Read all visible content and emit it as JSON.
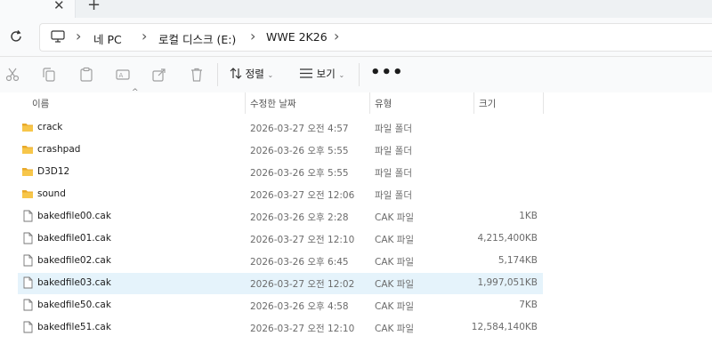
{
  "tab": {
    "close_glyph": "✕",
    "new_glyph": "+"
  },
  "breadcrumb": [
    "네 PC",
    "로컬 디스크 (E:)",
    "WWE 2K26"
  ],
  "toolbar": {
    "sort_label": "정렬",
    "view_label": "보기",
    "more_label": "•••"
  },
  "columns": {
    "name": "이름",
    "date": "수정한 날짜",
    "type": "유형",
    "size": "크기"
  },
  "files": [
    {
      "name": "crack",
      "date": "2026-03-27 오전 4:57",
      "type": "파일 폴더",
      "size": "",
      "kind": "folder"
    },
    {
      "name": "crashpad",
      "date": "2026-03-26 오후 5:55",
      "type": "파일 폴더",
      "size": "",
      "kind": "folder"
    },
    {
      "name": "D3D12",
      "date": "2026-03-26 오후 5:55",
      "type": "파일 폴더",
      "size": "",
      "kind": "folder"
    },
    {
      "name": "sound",
      "date": "2026-03-27 오전 12:06",
      "type": "파일 폴더",
      "size": "",
      "kind": "folder"
    },
    {
      "name": "bakedfile00.cak",
      "date": "2026-03-26 오후 2:28",
      "type": "CAK 파일",
      "size": "1KB",
      "kind": "file"
    },
    {
      "name": "bakedfile01.cak",
      "date": "2026-03-27 오전 12:10",
      "type": "CAK 파일",
      "size": "4,215,400KB",
      "kind": "file"
    },
    {
      "name": "bakedfile02.cak",
      "date": "2026-03-26 오후 6:45",
      "type": "CAK 파일",
      "size": "5,174KB",
      "kind": "file"
    },
    {
      "name": "bakedfile03.cak",
      "date": "2026-03-27 오전 12:02",
      "type": "CAK 파일",
      "size": "1,997,051KB",
      "kind": "file",
      "selected": true
    },
    {
      "name": "bakedfile50.cak",
      "date": "2026-03-26 오후 4:58",
      "type": "CAK 파일",
      "size": "7KB",
      "kind": "file"
    },
    {
      "name": "bakedfile51.cak",
      "date": "2026-03-27 오전 12:10",
      "type": "CAK 파일",
      "size": "12,584,140KB",
      "kind": "file"
    }
  ],
  "colors": {
    "folder": "#f7c64a",
    "folder_dark": "#e9a92a",
    "selected_row": "#e5f3fb",
    "accent": "#0067c0"
  }
}
